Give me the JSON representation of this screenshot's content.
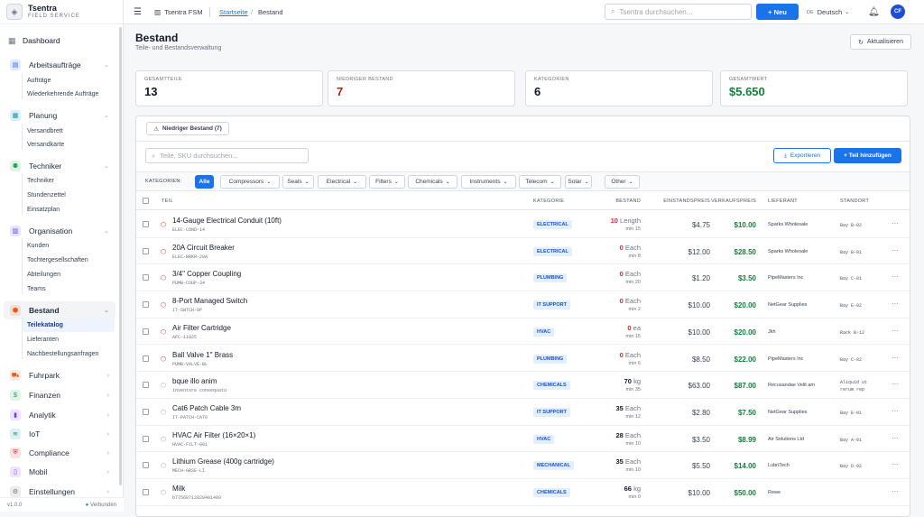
{
  "app": {
    "name": "Tsentra",
    "subtitle": "FIELD SERVICE",
    "version": "v1.0.0",
    "status": "Verbunden"
  },
  "sidebar": {
    "dashboard": "Dashboard",
    "groups": [
      {
        "label": "Arbeitsaufträge",
        "icon": "clipboard-icon",
        "color": "#2563eb",
        "children": [
          "Aufträge",
          "Wiederkehrende Aufträge"
        ]
      },
      {
        "label": "Planung",
        "icon": "calendar-icon",
        "color": "#0891b2",
        "children": [
          "Versandbrett",
          "Versandkarte"
        ]
      },
      {
        "label": "Techniker",
        "icon": "user-gear-icon",
        "color": "#16a34a",
        "children": [
          "Techniker",
          "Stundenzettel",
          "Einsatzplan"
        ]
      },
      {
        "label": "Organisation",
        "icon": "building-icon",
        "color": "#4f46e5",
        "children": [
          "Kunden",
          "Tochtergesellschaften",
          "Abteilungen",
          "Teams"
        ]
      },
      {
        "label": "Bestand",
        "icon": "box-icon",
        "color": "#ea580c",
        "children": [
          "Teilekatalog",
          "Lieferanten",
          "Nachbestellungsanfragen"
        ]
      },
      {
        "label": "Fuhrpark",
        "icon": "truck-icon",
        "color": "#ea580c",
        "children": []
      },
      {
        "label": "Finanzen",
        "icon": "dollar-icon",
        "color": "#16a34a",
        "children": []
      },
      {
        "label": "Analytik",
        "icon": "chart-icon",
        "color": "#7c3aed",
        "children": []
      },
      {
        "label": "IoT",
        "icon": "wifi-icon",
        "color": "#0d9488",
        "children": []
      },
      {
        "label": "Compliance",
        "icon": "shield-icon",
        "color": "#dc2626",
        "children": []
      },
      {
        "label": "Mobil",
        "icon": "phone-icon",
        "color": "#7c3aed",
        "children": []
      },
      {
        "label": "Einstellungen",
        "icon": "gear-icon",
        "color": "#6b7280",
        "children": []
      }
    ]
  },
  "topbar": {
    "workspace": "Tsentra FSM",
    "breadcrumb_home": "Startseite",
    "breadcrumb_current": "Bestand",
    "search_placeholder": "Tsentra durchsuchen...",
    "new_label": "+ Neu",
    "lang_code": "DE",
    "lang_label": "Deutsch",
    "avatar_initials": "CF"
  },
  "page": {
    "title": "Bestand",
    "subtitle": "Teile- und Bestandsverwaltung",
    "refresh_label": "Aktualisieren"
  },
  "stats": [
    {
      "label": "GESAMTTEILE",
      "value": "13",
      "color": "#111827"
    },
    {
      "label": "NIEDRIGER BESTAND",
      "value": "7",
      "color": "#b91c1c"
    },
    {
      "label": "KATEGORIEN",
      "value": "6",
      "color": "#111827"
    },
    {
      "label": "GESAMTWERT",
      "value": "$5.650",
      "color": "#15803d"
    }
  ],
  "toolbar": {
    "low_stock_label": "Niedriger Bestand (7)",
    "search_placeholder": "Teile, SKU durchsuchen...",
    "export_label": "Exportieren",
    "add_label": "+ Teil hinzufügen"
  },
  "filters": {
    "label": "KATEGORIEN:",
    "chips": [
      "Alle",
      "Compressors",
      "Seals",
      "Electrical",
      "Filters",
      "Chemicals",
      "Instruments",
      "Telecom",
      "Solar",
      "Other"
    ]
  },
  "table": {
    "headers": [
      "TEIL",
      "KATEGORIE",
      "BESTAND",
      "EINSTANDSPREIS",
      "VERKAUFSPREIS",
      "LIEFERANT",
      "STANDORT"
    ],
    "rows": [
      {
        "name": "14-Gauge Electrical Conduit (10ft)",
        "sku": "ELEC-COND-14",
        "category": "ELECTRICAL",
        "qty": "10",
        "unit": "Length",
        "min": "min 15",
        "low": true,
        "cost": "$4.75",
        "price": "$10.00",
        "supplier": "Sparks Wholesale",
        "location": "Bay B-02"
      },
      {
        "name": "20A Circuit Breaker",
        "sku": "ELEC-BRKR-20A",
        "category": "ELECTRICAL",
        "qty": "0",
        "unit": "Each",
        "min": "min 8",
        "low": true,
        "cost": "$12.00",
        "price": "$28.50",
        "supplier": "Sparks Wholesale",
        "location": "Bay B-01"
      },
      {
        "name": "3/4\" Copper Coupling",
        "sku": "PUMB-COUP-34",
        "category": "PLUMBING",
        "qty": "0",
        "unit": "Each",
        "min": "min 20",
        "low": true,
        "cost": "$1.20",
        "price": "$3.50",
        "supplier": "PipeMasters Inc",
        "location": "Bay C-01"
      },
      {
        "name": "8-Port Managed Switch",
        "sku": "IT-SWTCH-8P",
        "category": "IT SUPPORT",
        "qty": "0",
        "unit": "Each",
        "min": "min 2",
        "low": true,
        "cost": "$10.00",
        "price": "$20.00",
        "supplier": "NetGear Supplies",
        "location": "Bay E-02"
      },
      {
        "name": "Air Filter Cartridge",
        "sku": "AFC-11025",
        "category": "HVAC",
        "qty": "0",
        "unit": "ea",
        "min": "min 15",
        "low": true,
        "cost": "$10.00",
        "price": "$20.00",
        "supplier": "Jkh",
        "location": "Rack B-12"
      },
      {
        "name": "Ball Valve 1\" Brass",
        "sku": "PUMB-VALVE-BL",
        "category": "PLUMBING",
        "qty": "0",
        "unit": "Each",
        "min": "min 6",
        "low": true,
        "cost": "$8.50",
        "price": "$22.00",
        "supplier": "PipeMasters Inc",
        "location": "Bay C-02"
      },
      {
        "name": "bque illo anim",
        "sku": "inventore consequatu",
        "category": "CHEMICALS",
        "qty": "70",
        "unit": "kg",
        "min": "min 35",
        "low": false,
        "cost": "$63.00",
        "price": "$87.00",
        "supplier": "Recusandae Velit am",
        "location": "Aliquid ut\nrerum rep"
      },
      {
        "name": "Cat6 Patch Cable 3m",
        "sku": "IT-PATCH-CAT6",
        "category": "IT SUPPORT",
        "qty": "35",
        "unit": "Each",
        "min": "min 12",
        "low": false,
        "cost": "$2.80",
        "price": "$7.50",
        "supplier": "NetGear Supplies",
        "location": "Bay E-01"
      },
      {
        "name": "HVAC Air Filter (16×20×1)",
        "sku": "HVAC-FILT-001",
        "category": "HVAC",
        "qty": "28",
        "unit": "Each",
        "min": "min 10",
        "low": false,
        "cost": "$3.50",
        "price": "$8.99",
        "supplier": "Air Solutions Ltd",
        "location": "Bay A-01"
      },
      {
        "name": "Lithium Grease (400g cartridge)",
        "sku": "MECH-GRSE-LI",
        "category": "MECHANICAL",
        "qty": "35",
        "unit": "Each",
        "min": "min 10",
        "low": false,
        "cost": "$5.50",
        "price": "$14.00",
        "supplier": "LubriTech",
        "location": "Bay D-02"
      },
      {
        "name": "Milk",
        "sku": "b77568712820481489",
        "category": "CHEMICALS",
        "qty": "66",
        "unit": "kg",
        "min": "min 0",
        "low": false,
        "cost": "$10.00",
        "price": "$50.00",
        "supplier": "Rewe",
        "location": ""
      }
    ]
  }
}
